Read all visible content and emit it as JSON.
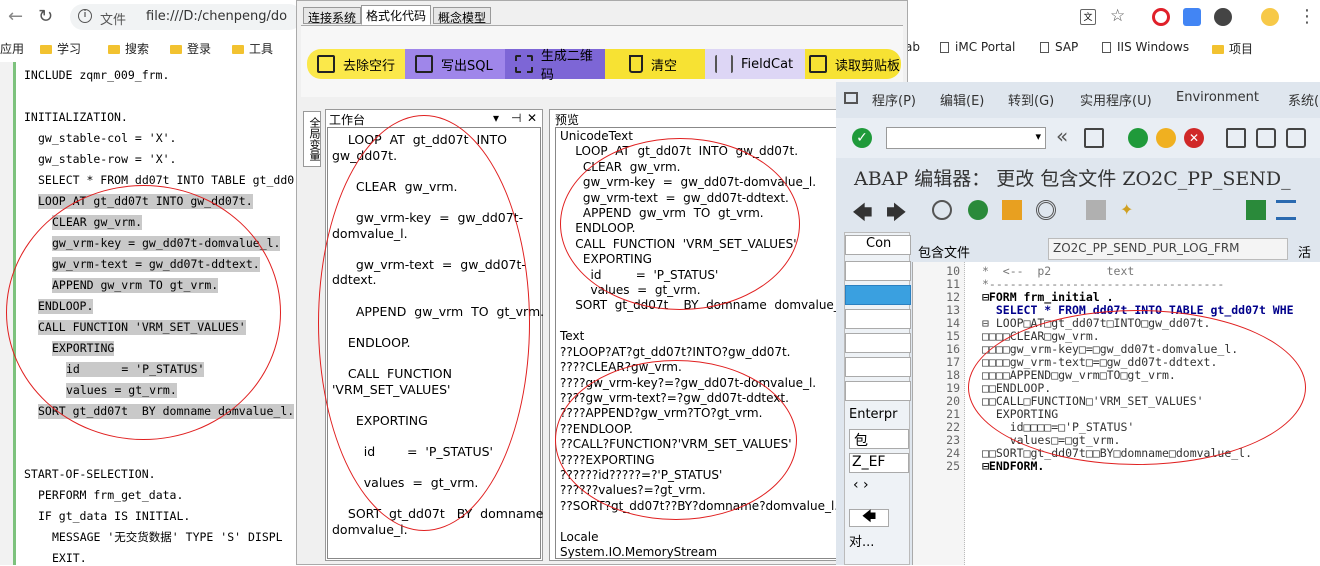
{
  "browser": {
    "address_prefix": "文件",
    "address": "file:///D:/chenpeng/do",
    "bookmarks": [
      {
        "label": "应用",
        "type": "apps"
      },
      {
        "label": "学习",
        "type": "folder"
      },
      {
        "label": "搜索",
        "type": "folder"
      },
      {
        "label": "登录",
        "type": "folder"
      },
      {
        "label": "工具",
        "type": "folder"
      },
      {
        "label": "ab",
        "type": "text"
      },
      {
        "label": "iMC Portal",
        "type": "doc"
      },
      {
        "label": "SAP",
        "type": "doc"
      },
      {
        "label": "IIS Windows",
        "type": "doc"
      },
      {
        "label": "项目",
        "type": "folder"
      }
    ]
  },
  "left_code": {
    "lines": [
      {
        "text": "INCLUDE zqmr_009_frm.",
        "hl": false,
        "ind": 0
      },
      {
        "text": "",
        "hl": false,
        "ind": 0
      },
      {
        "text": "INITIALIZATION.",
        "hl": false,
        "ind": 0
      },
      {
        "text": "gw_stable-col = 'X'.",
        "hl": false,
        "ind": 1
      },
      {
        "text": "gw_stable-row = 'X'.",
        "hl": false,
        "ind": 1
      },
      {
        "text": "SELECT * FROM dd07t INTO TABLE gt_dd0",
        "hl": false,
        "ind": 1
      },
      {
        "text": "LOOP AT gt_dd07t INTO gw_dd07t.",
        "hl": true,
        "ind": 1
      },
      {
        "text": "CLEAR gw_vrm.",
        "hl": true,
        "ind": 2
      },
      {
        "text": "gw_vrm-key = gw_dd07t-domvalue_l.",
        "hl": true,
        "ind": 2
      },
      {
        "text": "gw_vrm-text = gw_dd07t-ddtext.",
        "hl": true,
        "ind": 2
      },
      {
        "text": "APPEND gw_vrm TO gt_vrm.",
        "hl": true,
        "ind": 2
      },
      {
        "text": "ENDLOOP.",
        "hl": true,
        "ind": 1
      },
      {
        "text": "CALL FUNCTION 'VRM_SET_VALUES'",
        "hl": true,
        "ind": 1
      },
      {
        "text": "EXPORTING",
        "hl": true,
        "ind": 2
      },
      {
        "text": "id      = 'P_STATUS'",
        "hl": true,
        "ind": 3
      },
      {
        "text": "values = gt_vrm.",
        "hl": true,
        "ind": 3
      },
      {
        "text": "SORT gt_dd07t  BY domname domvalue_l.",
        "hl": true,
        "ind": 1
      },
      {
        "text": "",
        "hl": false,
        "ind": 0
      },
      {
        "text": "",
        "hl": false,
        "ind": 0
      },
      {
        "text": "START-OF-SELECTION.",
        "hl": false,
        "ind": 0
      },
      {
        "text": "PERFORM frm_get_data.",
        "hl": false,
        "ind": 1
      },
      {
        "text": "IF gt_data IS INITIAL.",
        "hl": false,
        "ind": 1
      },
      {
        "text": "MESSAGE '无交货数据' TYPE 'S' DISPL",
        "hl": false,
        "ind": 2
      },
      {
        "text": "EXIT.",
        "hl": false,
        "ind": 2
      }
    ]
  },
  "tool": {
    "tabs": [
      {
        "label": "连接系统",
        "active": false
      },
      {
        "label": "格式化代码",
        "active": true
      },
      {
        "label": "概念模型",
        "active": false
      }
    ],
    "buttons": [
      {
        "label": "去除空行",
        "color": "#fbe84a"
      },
      {
        "label": "写出SQL",
        "color": "#9f86ea"
      },
      {
        "label": "生成二维码",
        "color": "#7d66d6"
      },
      {
        "label": "清空",
        "color": "#f7e233"
      },
      {
        "label": "FieldCat",
        "color": "#ddd6f5"
      },
      {
        "label": "读取剪贴板",
        "color": "#f7e233"
      }
    ],
    "side_tab": "全局变量",
    "workbench_title": "工作台",
    "workbench_controls": [
      "▾",
      "⊣",
      "✕"
    ],
    "workbench_text": "    LOOP  AT  gt_dd07t  INTO\ngw_dd07t.\n\n      CLEAR  gw_vrm.\n\n      gw_vrm-key  =  gw_dd07t-\ndomvalue_l.\n\n      gw_vrm-text  =  gw_dd07t-\nddtext.\n\n      APPEND  gw_vrm  TO  gt_vrm.\n\n    ENDLOOP.\n\n    CALL  FUNCTION\n'VRM_SET_VALUES'\n\n      EXPORTING\n\n        id        =  'P_STATUS'\n\n        values  =  gt_vrm.\n\n    SORT  gt_dd07t   BY  domname\ndomvalue_l.",
    "preview_title": "预览",
    "preview_text": "UnicodeText\n    LOOP  AT  gt_dd07t  INTO  gw_dd07t.\n      CLEAR  gw_vrm.\n      gw_vrm-key  =  gw_dd07t-domvalue_l.\n      gw_vrm-text  =  gw_dd07t-ddtext.\n      APPEND  gw_vrm  TO  gt_vrm.\n    ENDLOOP.\n    CALL  FUNCTION  'VRM_SET_VALUES'\n      EXPORTING\n        id         =  'P_STATUS'\n        values  =  gt_vrm.\n    SORT  gt_dd07t    BY  domname  domvalue_l.\n\nText\n??LOOP?AT?gt_dd07t?INTO?gw_dd07t.\n????CLEAR?gw_vrm.\n????gw_vrm-key?=?gw_dd07t-domvalue_l.\n????gw_vrm-text?=?gw_dd07t-ddtext.\n????APPEND?gw_vrm?TO?gt_vrm.\n??ENDLOOP.\n??CALL?FUNCTION?'VRM_SET_VALUES'\n????EXPORTING\n??????id?????=?'P_STATUS'\n??????values?=?gt_vrm.\n??SORT?gt_dd07t??BY?domname?domvalue_l.\n\nLocale\nSystem.IO.MemoryStream"
  },
  "sap": {
    "menu": [
      "程序(P)",
      "编辑(E)",
      "转到(G)",
      "实用程序(U)",
      "Environment",
      "系统("
    ],
    "title": "ABAP 编辑器： 更改 包含文件 ZO2C_PP_SEND_",
    "include_label": "包含文件",
    "include_value": "ZO2C_PP_SEND_PUR_LOG_FRM",
    "active_label": "活动",
    "side_labels": [
      "Con",
      "Enterpr",
      "包",
      "Z_EF",
      "对..."
    ],
    "code": [
      {
        "num": "10",
        "text": "*  <--  p2        text",
        "c": "comment"
      },
      {
        "num": "11",
        "text": "*----------------------------------",
        "c": "comment"
      },
      {
        "num": "12",
        "text": "⊟FORM frm_initial .",
        "c": "kw"
      },
      {
        "num": "13",
        "text": "  SELECT * FROM dd07t INTO TABLE gt_dd07t WHE",
        "c": "kw2"
      },
      {
        "num": "14",
        "text": "⊟ LOOP□AT□gt_dd07t□INTO□gw_dd07t.",
        "c": "normal"
      },
      {
        "num": "15",
        "text": "□□□□CLEAR□gw_vrm.",
        "c": "normal"
      },
      {
        "num": "16",
        "text": "□□□□gw_vrm-key□=□gw_dd07t-domvalue_l.",
        "c": "normal"
      },
      {
        "num": "17",
        "text": "□□□□gw_vrm-text□=□gw_dd07t-ddtext.",
        "c": "normal"
      },
      {
        "num": "18",
        "text": "□□□□APPEND□gw_vrm□TO□gt_vrm.",
        "c": "normal"
      },
      {
        "num": "19",
        "text": "□□ENDLOOP.",
        "c": "normal"
      },
      {
        "num": "20",
        "text": "□□CALL□FUNCTION□'VRM_SET_VALUES'",
        "c": "normal"
      },
      {
        "num": "21",
        "text": "  EXPORTING",
        "c": "normal"
      },
      {
        "num": "22",
        "text": "    id□□□□=□'P_STATUS'",
        "c": "normal"
      },
      {
        "num": "23",
        "text": "    values□=□gt_vrm.",
        "c": "normal"
      },
      {
        "num": "24",
        "text": "□□SORT□gt_dd07t□□BY□domname□domvalue_l.",
        "c": "normal"
      },
      {
        "num": "25",
        "text": "⊟ENDFORM.",
        "c": "kw"
      }
    ]
  },
  "colors": {
    "accent_green": "#7dc27d",
    "annotation": "#e02020",
    "sap_bg": "#dfe6ee"
  }
}
